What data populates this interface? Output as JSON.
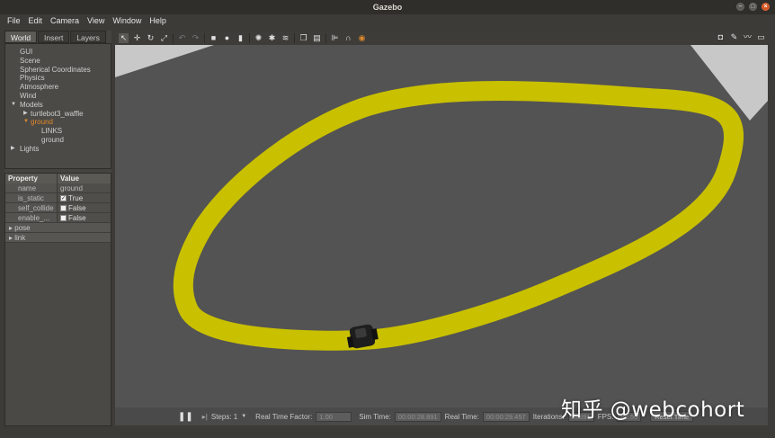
{
  "window": {
    "title": "Gazebo"
  },
  "menu": [
    "File",
    "Edit",
    "Camera",
    "View",
    "Window",
    "Help"
  ],
  "tabs": [
    "World",
    "Insert",
    "Layers"
  ],
  "tree": {
    "gui": "GUI",
    "scene": "Scene",
    "spherical": "Spherical Coordinates",
    "physics": "Physics",
    "atmosphere": "Atmosphere",
    "wind": "Wind",
    "models": "Models",
    "turtlebot": "turtlebot3_waffle",
    "ground_sel": "ground",
    "links": "LINKS",
    "ground_link": "ground",
    "lights": "Lights"
  },
  "properties": {
    "header_property": "Property",
    "header_value": "Value",
    "rows": [
      {
        "key": "name",
        "value": "ground"
      },
      {
        "key": "is_static",
        "value": "True"
      },
      {
        "key": "self_collide",
        "value": "False"
      },
      {
        "key": "enable_...",
        "value": "False"
      }
    ],
    "groups": [
      "pose",
      "link"
    ]
  },
  "bottom": {
    "steps_label": "Steps: 1",
    "rtf_label": "Real Time Factor:",
    "rtf_value": "1.00",
    "sim_label": "Sim Time:",
    "sim_value": "00:00:28.891",
    "real_label": "Real Time:",
    "real_value": "00:00:29.457",
    "iter_label": "Iterations:",
    "iter_value": "28891",
    "fps_label": "FPS:",
    "fps_value": "62.50",
    "reset_label": "Reset Time"
  },
  "watermark": "知乎 @webcohort",
  "colors": {
    "track": "#c9c000",
    "ground": "#535353",
    "selected": "#e08a2c"
  }
}
